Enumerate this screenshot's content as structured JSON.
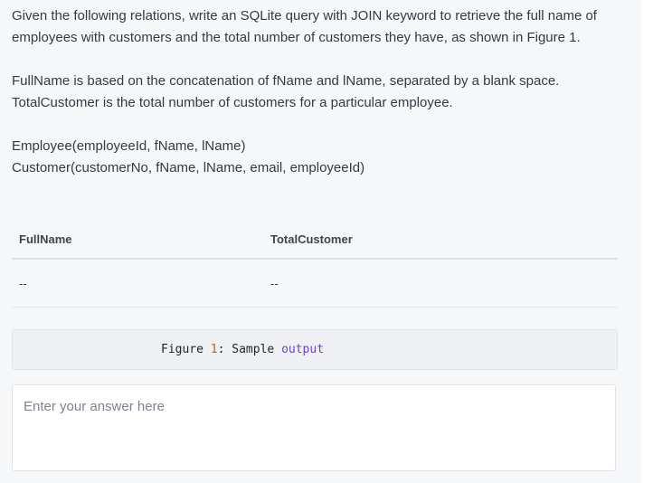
{
  "question": {
    "intro": "Given the following relations, write an SQLite query with JOIN keyword to retrieve the full name of employees with customers and the total number of customers they have, as shown in Figure 1.",
    "fullname_def": "FullName is based on the concatenation of fName and lName, separated by a blank space.",
    "total_def": "TotalCustomer is the total number of customers for a particular employee.",
    "relation_employee": "Employee(employeeId, fName, lName)",
    "relation_customer": "Customer(customerNo, fName, lName, email, employeeId)"
  },
  "sample_table": {
    "headers": [
      "FullName",
      "TotalCustomer"
    ],
    "rows": [
      [
        "--",
        "--"
      ]
    ]
  },
  "figure": {
    "label": "Figure",
    "number": "1",
    "separator": ": Sample ",
    "keyword": "output"
  },
  "answer": {
    "placeholder": "Enter your answer here",
    "value": ""
  },
  "colors": {
    "page_background": "#f6f7f9",
    "text": "#333a45",
    "code_number": "#b5651d",
    "code_keyword": "#6f42c1"
  }
}
